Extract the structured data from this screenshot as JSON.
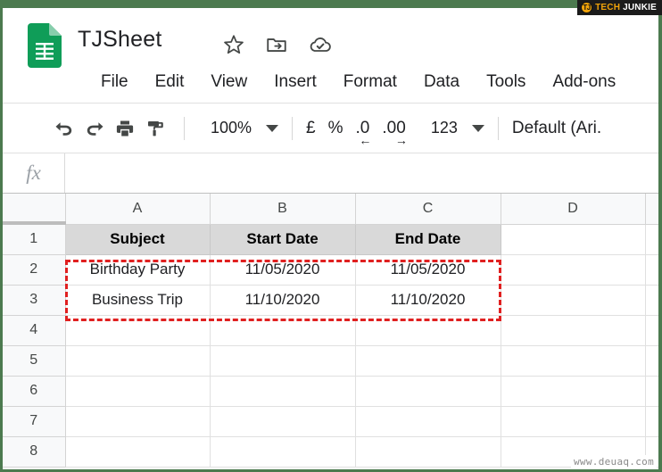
{
  "brand": {
    "badge": "TJ",
    "name_primary": "TECH",
    "name_secondary": "JUNKIE"
  },
  "header": {
    "app_icon": "google-sheets-icon",
    "doc_title": "TJSheet",
    "icons": [
      {
        "name": "star-icon",
        "label": "Star"
      },
      {
        "name": "move-to-folder-icon",
        "label": "Move"
      },
      {
        "name": "cloud-saved-icon",
        "label": "Saved to Drive"
      }
    ],
    "menu": [
      {
        "label": "File"
      },
      {
        "label": "Edit"
      },
      {
        "label": "View"
      },
      {
        "label": "Insert"
      },
      {
        "label": "Format"
      },
      {
        "label": "Data"
      },
      {
        "label": "Tools"
      },
      {
        "label": "Add-ons"
      }
    ]
  },
  "toolbar": {
    "undo": "undo-icon",
    "redo": "redo-icon",
    "print": "print-icon",
    "paint_format": "paint-format-icon",
    "zoom_value": "100%",
    "currency_symbol": "£",
    "percent_symbol": "%",
    "decrease_decimal": ".0",
    "decrease_decimal_arrow": "←",
    "increase_decimal": ".00",
    "increase_decimal_arrow": "→",
    "more_formats": "123",
    "font_name": "Default (Ari."
  },
  "formula_bar": {
    "fx_label": "fx",
    "value": ""
  },
  "grid": {
    "columns": [
      "A",
      "B",
      "C",
      "D",
      ""
    ],
    "rows": [
      "1",
      "2",
      "3",
      "4",
      "5",
      "6",
      "7",
      "8"
    ],
    "cells": [
      [
        "Subject",
        "Start Date",
        "End Date",
        "",
        ""
      ],
      [
        "Birthday Party",
        "11/05/2020",
        "11/05/2020",
        "",
        ""
      ],
      [
        "Business Trip",
        "11/10/2020",
        "11/10/2020",
        "",
        ""
      ],
      [
        "",
        "",
        "",
        "",
        ""
      ],
      [
        "",
        "",
        "",
        "",
        ""
      ],
      [
        "",
        "",
        "",
        "",
        ""
      ],
      [
        "",
        "",
        "",
        "",
        ""
      ],
      [
        "",
        "",
        "",
        "",
        ""
      ]
    ],
    "selection_label": "A2:C3",
    "selection_color": "#e02020",
    "header_row_fill": "#d9d9d9"
  },
  "watermark": {
    "text": "www.deuaq.com"
  }
}
